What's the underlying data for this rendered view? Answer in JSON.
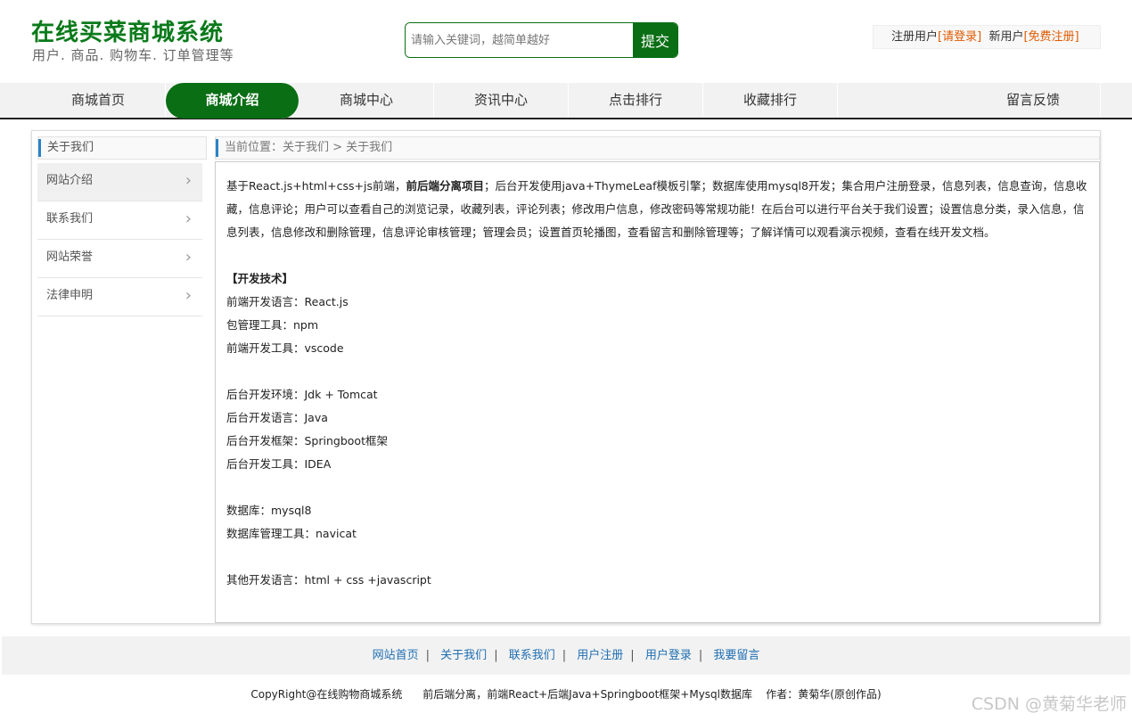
{
  "header": {
    "title": "在线买菜商城系统",
    "subtitle": "用户. 商品. 购物车. 订单管理等",
    "search_placeholder": "请输入关键词，越简单越好",
    "search_button": "提交",
    "user_text1": "注册用户",
    "login_link": "[请登录]",
    "user_text2": "新用户",
    "register_link": "[免费注册]"
  },
  "nav": {
    "items": [
      {
        "label": "商城首页"
      },
      {
        "label": "商城介绍"
      },
      {
        "label": "商城中心"
      },
      {
        "label": "资讯中心"
      },
      {
        "label": "点击排行"
      },
      {
        "label": "收藏排行"
      },
      {
        "label": "留言反馈"
      }
    ],
    "active_index": 1
  },
  "sidebar": {
    "title": "关于我们",
    "items": [
      {
        "label": "网站介绍"
      },
      {
        "label": "联系我们"
      },
      {
        "label": "网站荣誉"
      },
      {
        "label": "法律申明"
      }
    ]
  },
  "breadcrumb": "当前位置：关于我们 > 关于我们",
  "article": {
    "intro_part1": "基于React.js+html+css+js前端，",
    "intro_bold": "前后端分离项目",
    "intro_part2": "；后台开发使用java+ThymeLeaf模板引擎；数据库使用mysql8开发；集合用户注册登录，信息列表，信息查询，信息收藏，信息评论；用户可以查看自己的浏览记录，收藏列表，评论列表；修改用户信息，修改密码等常规功能！在后台可以进行平台关于我们设置；设置信息分类，录入信息，信息列表，信息修改和删除管理，信息评论审核管理；管理会员；设置首页轮播图，查看留言和删除管理等；了解详情可以观看演示视频，查看在线开发文档。",
    "tech_heading": "【开发技术】",
    "line_fe_lang": "前端开发语言：React.js",
    "line_pkg": "包管理工具：npm",
    "line_fe_tool": "前端开发工具：vscode",
    "line_be_env": "后台开发环境：Jdk + Tomcat",
    "line_be_lang": "后台开发语言：Java",
    "line_be_fw": "后台开发框架：Springboot框架",
    "line_be_tool": "后台开发工具：IDEA",
    "line_db": "数据库：mysql8",
    "line_db_tool": "数据库管理工具：navicat",
    "line_other": "其他开发语言：html + css +javascript"
  },
  "footer": {
    "links": [
      {
        "label": "网站首页"
      },
      {
        "label": "关于我们"
      },
      {
        "label": "联系我们"
      },
      {
        "label": "用户注册"
      },
      {
        "label": "用户登录"
      },
      {
        "label": "我要留言"
      }
    ],
    "separator": "|",
    "copyright": "CopyRight@在线购物商城系统      前后端分离，前端React+后端Java+Springboot框架+Mysql数据库    作者：黄菊华(原创作品)"
  },
  "watermark": "CSDN @黄菊华老师"
}
